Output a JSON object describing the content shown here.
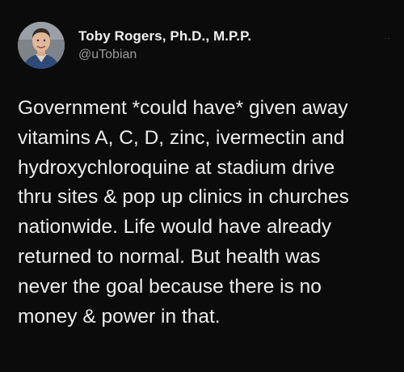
{
  "tweet": {
    "author": {
      "display_name": "Toby Rogers, Ph.D., M.P.P.",
      "handle": "@uTobian",
      "avatar_icon": "profile-photo"
    },
    "more_icon": "more-dots-icon",
    "more_glyph": "··",
    "text": "Government *could have* given away\nvitamins A, C, D, zinc, ivermectin and\nhydroxychloroquine at stadium drive\nthru sites & pop up clinics in churches\nnationwide. Life would have already\nreturned to normal. But health was\nnever the goal because there is no\nmoney & power in that."
  },
  "colors": {
    "background": "#0b0b0b",
    "text": "#ececec",
    "handle": "#9a9a9a"
  }
}
